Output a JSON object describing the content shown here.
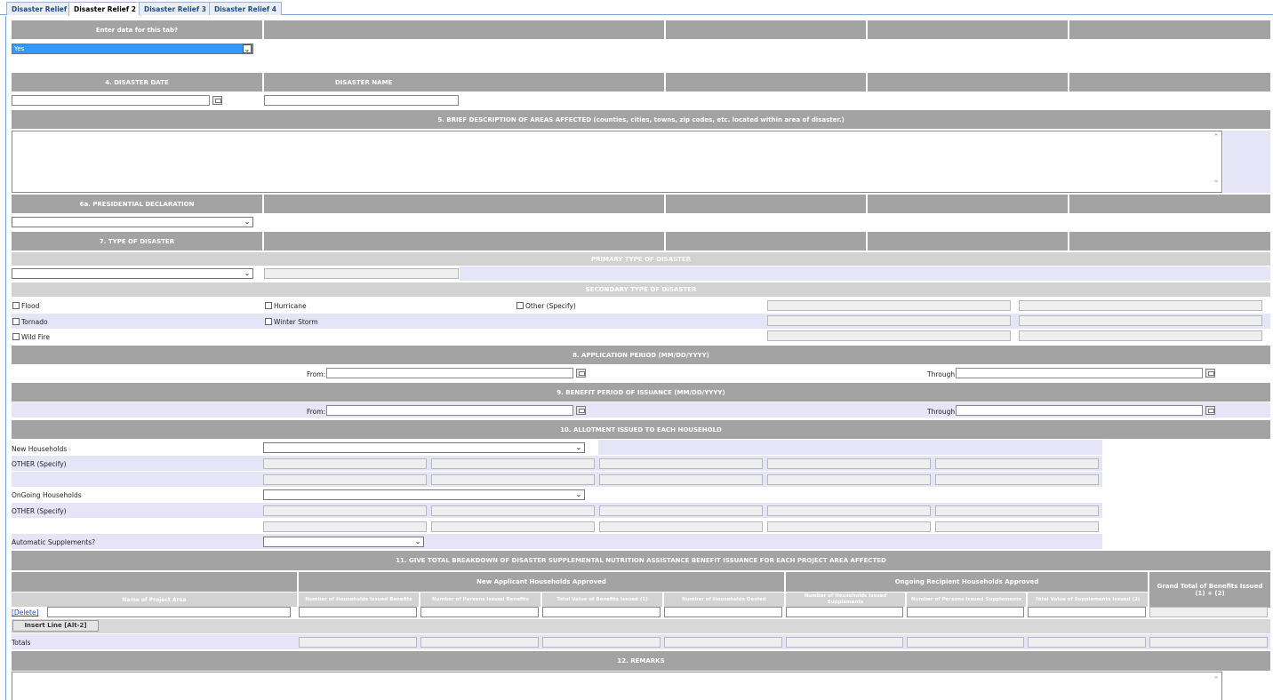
{
  "tabs": [
    "Disaster Relief",
    "Disaster Relief 2",
    "Disaster Relief 3",
    "Disaster Relief 4"
  ],
  "enter_data": {
    "header": "Enter data for this tab?",
    "value": "Yes"
  },
  "disaster_date": {
    "header": "4. DISASTER DATE"
  },
  "disaster_name": {
    "header": "DISASTER NAME"
  },
  "areas_affected": {
    "header": "5. BRIEF DESCRIPTION OF AREAS AFFECTED (counties, cities, towns, zip codes, etc. located within area of disaster.)"
  },
  "presidential": {
    "header": "6a. PRESIDENTIAL DECLARATION"
  },
  "type_of_disaster": {
    "header": "7. TYPE OF DISASTER",
    "primary_header": "PRIMARY TYPE OF DISASTER",
    "secondary_header": "SECONDARY TYPE OF DISASTER",
    "checkboxes": [
      "Flood",
      "Hurricane",
      "Other (Specify)",
      "Tornado",
      "Winter Storm",
      "Wild Fire"
    ]
  },
  "application_period": {
    "header": "8. APPLICATION PERIOD (MM/DD/YYYY)",
    "from": "From:",
    "through": "Through:"
  },
  "benefit_period": {
    "header": "9. BENEFIT PERIOD OF ISSUANCE (MM/DD/YYYY)",
    "from": "From:",
    "through": "Through:"
  },
  "allotment": {
    "header": "10. ALLOTMENT ISSUED TO EACH HOUSEHOLD",
    "new_households": "New Households",
    "other_specify_1": "OTHER (Specify)",
    "ongoing_households": "OnGoing Households",
    "other_specify_2": "OTHER (Specify)",
    "automatic": "Automatic Supplements?"
  },
  "breakdown": {
    "header": "11. GIVE TOTAL BREAKDOWN OF DISASTER SUPPLEMENTAL NUTRITION ASSISTANCE BENEFIT ISSUANCE FOR EACH PROJECT AREA AFFECTED",
    "group_new": "New Applicant Households Approved",
    "group_ongoing": "Ongoing Recipient Households Approved",
    "grand_total": "Grand Total of Benefits Issued (1) + (2)",
    "columns": [
      "Name of Project Area",
      "Number of Households Issued Benefits",
      "Number of Persons Issued Benefits",
      "Total Value of Benefits Issued (1)",
      "Number of Households Denied",
      "Number of Households Issued Supplements",
      "Number of Persons Issued Supplements",
      "Total Value of Supplements Issued (2)"
    ],
    "delete_link": "[Delete]",
    "insert_button": "Insert Line [Alt-2]",
    "totals_label": "Totals"
  },
  "remarks": {
    "header": "12. REMARKS"
  },
  "icons": {
    "calendar": "calendar-icon",
    "dropdown": "chevron-down-icon",
    "checkbox": "checkbox-icon"
  },
  "colors": {
    "header_gray": "#a3a3a3",
    "subheader_gray": "#d2d2d2",
    "row_lavender": "#e5e5f7",
    "selection_blue": "#3399ff",
    "tab_border": "#7aa3cf"
  }
}
